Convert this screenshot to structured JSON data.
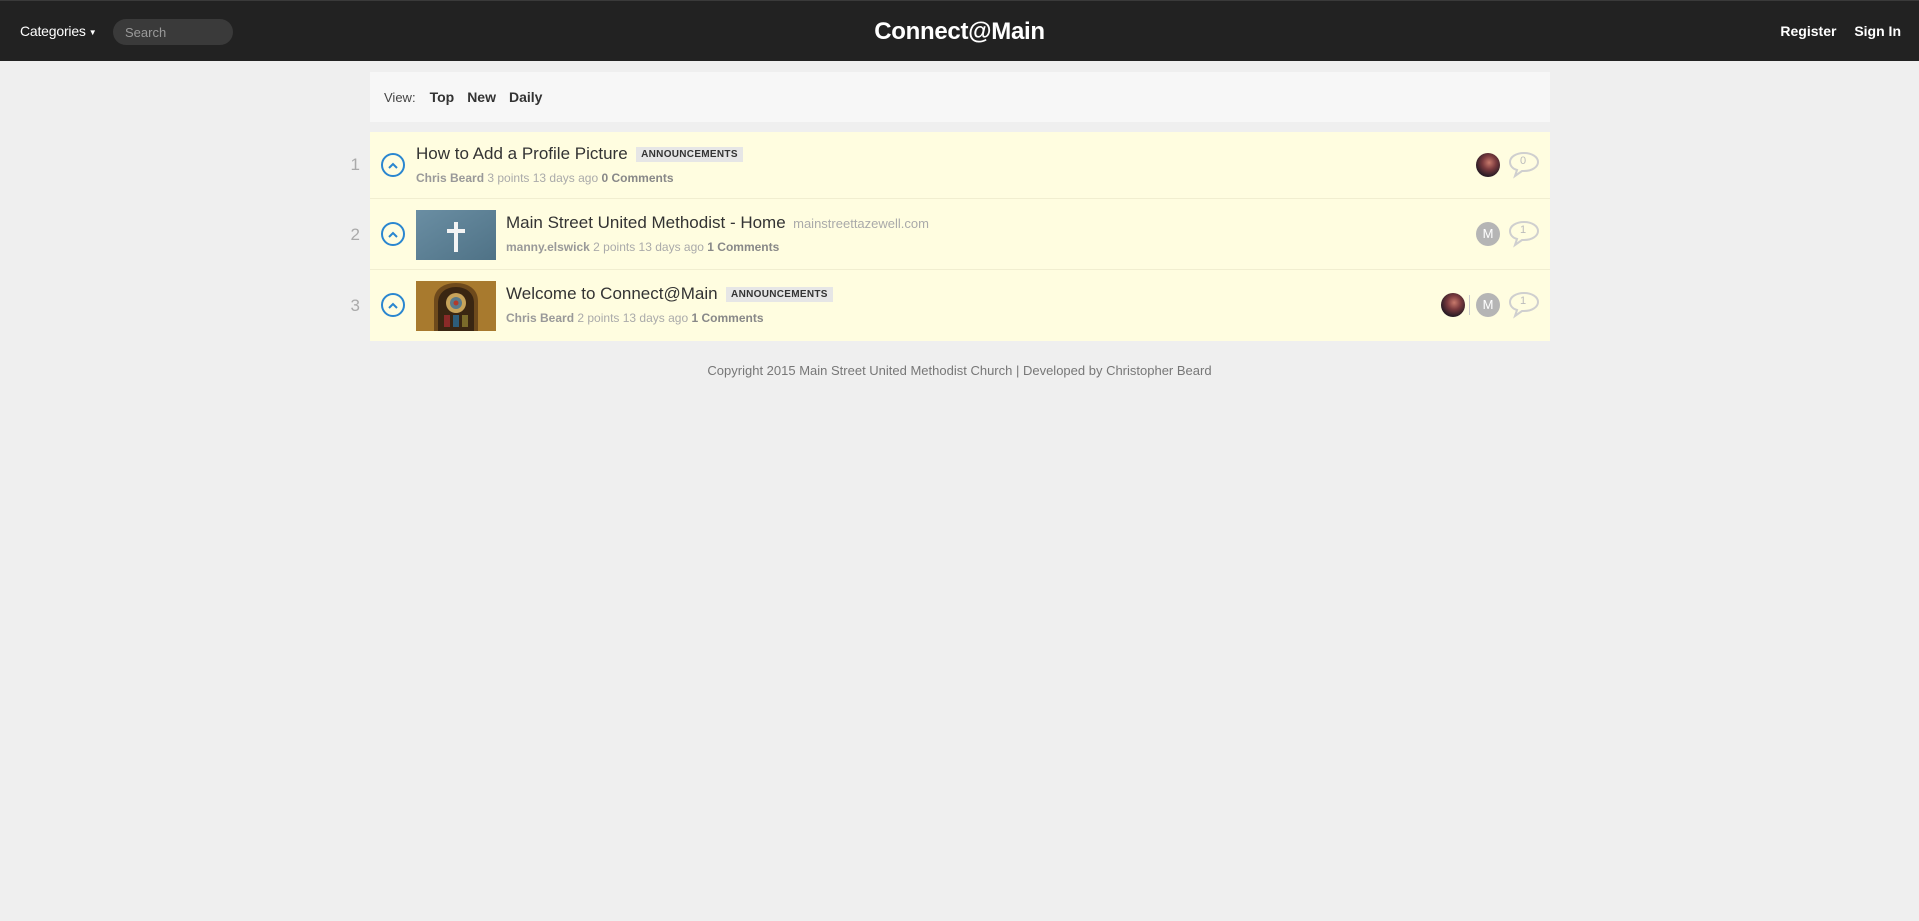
{
  "header": {
    "categories_label": "Categories",
    "search_placeholder": "Search",
    "brand": "Connect@Main",
    "register": "Register",
    "sign_in": "Sign In"
  },
  "view_bar": {
    "label": "View:",
    "options": [
      "Top",
      "New",
      "Daily"
    ]
  },
  "posts": [
    {
      "rank": "1",
      "title": "How to Add a Profile Picture",
      "category": "ANNOUNCEMENTS",
      "domain": "",
      "author": "Chris Beard",
      "points": "3 points",
      "age": "13 days ago",
      "comments": "0 Comments",
      "comment_count": "0",
      "thumbnail": "none",
      "commenters": [
        "photo"
      ]
    },
    {
      "rank": "2",
      "title": "Main Street United Methodist - Home",
      "category": "",
      "domain": "mainstreettazewell.com",
      "author": "manny.elswick",
      "points": "2 points",
      "age": "13 days ago",
      "comments": "1 Comments",
      "comment_count": "1",
      "thumbnail": "cross-image",
      "commenters": [
        "M"
      ]
    },
    {
      "rank": "3",
      "title": "Welcome to Connect@Main",
      "category": "ANNOUNCEMENTS",
      "domain": "",
      "author": "Chris Beard",
      "points": "2 points",
      "age": "13 days ago",
      "comments": "1 Comments",
      "comment_count": "1",
      "thumbnail": "stained-glass-image",
      "commenters": [
        "photo",
        "M"
      ]
    }
  ],
  "footer": {
    "text": "Copyright 2015 Main Street United Methodist Church | Developed by Christopher Beard"
  },
  "colors": {
    "header_bg": "#222222",
    "page_bg": "#efefef",
    "post_bg": "#fffde0",
    "upvote_accent": "#2a86d0"
  }
}
